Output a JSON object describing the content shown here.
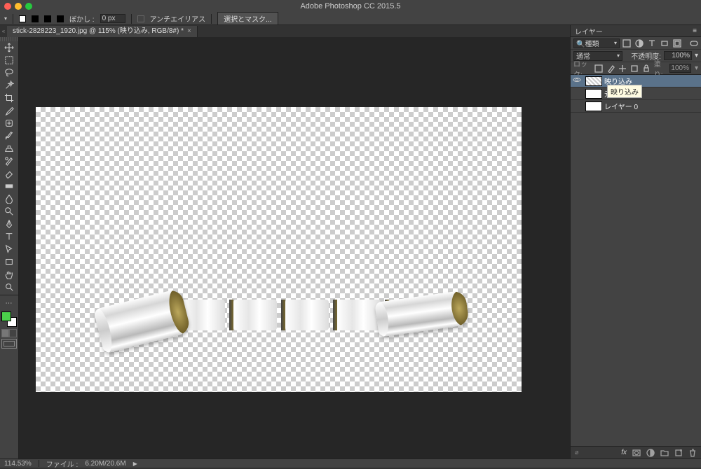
{
  "titlebar": {
    "title": "Adobe Photoshop CC 2015.5"
  },
  "options_bar": {
    "feather_label": "ぼかし :",
    "feather_value": "0 px",
    "antialias_label": "アンチエイリアス",
    "select_mask_btn": "選択とマスク..."
  },
  "doc_tab": {
    "label": "stick-2828223_1920.jpg @ 115% (映り込み, RGB/8#) *"
  },
  "layers_panel": {
    "title": "レイヤー",
    "filter_label": "種類",
    "blend_mode": "通常",
    "opacity_label": "不透明度:",
    "opacity_value": "100%",
    "lock_label": "ロック:",
    "fill_label": "塗り:",
    "fill_value": "100%",
    "layers": [
      {
        "name": "映り込み",
        "visible": true,
        "selected": true
      },
      {
        "name": "元画",
        "visible": false,
        "selected": false
      },
      {
        "name": "レイヤー 0",
        "visible": false,
        "selected": false
      }
    ],
    "tooltip": "映り込み",
    "footer_fx": "fx"
  },
  "status_bar": {
    "zoom": "114.53%",
    "info_label": "ファイル :",
    "info_value": "6.20M/20.6M"
  }
}
